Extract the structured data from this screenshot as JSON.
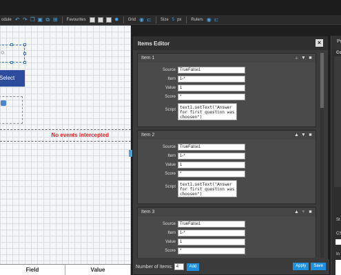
{
  "toolbar": {
    "module_label": "odule",
    "favourites_label": "Favourites",
    "grid_label": "Grid",
    "size_label": "Size",
    "size_value": "5",
    "size_unit": "px",
    "rulers_label": "Rulers"
  },
  "canvas": {
    "select_button_label": "Select",
    "no_events_text": "No events intercepted",
    "table_headers": [
      "Field",
      "Value"
    ]
  },
  "items_editor": {
    "title": "Items Editor",
    "field_labels": {
      "source": "Source",
      "item": "Item",
      "value": "Value",
      "score": "Score",
      "script": "Script"
    },
    "items": [
      {
        "title": "Item 1",
        "source": "TrueFalse1",
        "item": "1-*",
        "value": "1",
        "score": "*",
        "script": "text1.setText(\"Answer\nfor first question was\nchoosen\")"
      },
      {
        "title": "Item 2",
        "source": "TrueFalse1",
        "item": "1-*",
        "value": "1",
        "score": "*",
        "script": "text1.setText(\"Answer\nfor first question was\nchoosen\")"
      },
      {
        "title": "Item 3",
        "source": "TrueFalse1",
        "item": "1-*",
        "value": "1",
        "score": "*",
        "script": ""
      }
    ],
    "footer": {
      "number_of_items_label": "Number of Items:",
      "number_of_items_value": "4",
      "add_label": "Add",
      "apply_label": "Apply",
      "save_label": "Save"
    }
  },
  "right_panel": {
    "header": "Pr",
    "sub_header": "Co",
    "label_st": "St",
    "label_cs": "CS",
    "label_in": "In"
  },
  "colors": {
    "accent": "#1e90e0",
    "error_text": "#e21e1e",
    "select_button": "#2d4c9e"
  }
}
